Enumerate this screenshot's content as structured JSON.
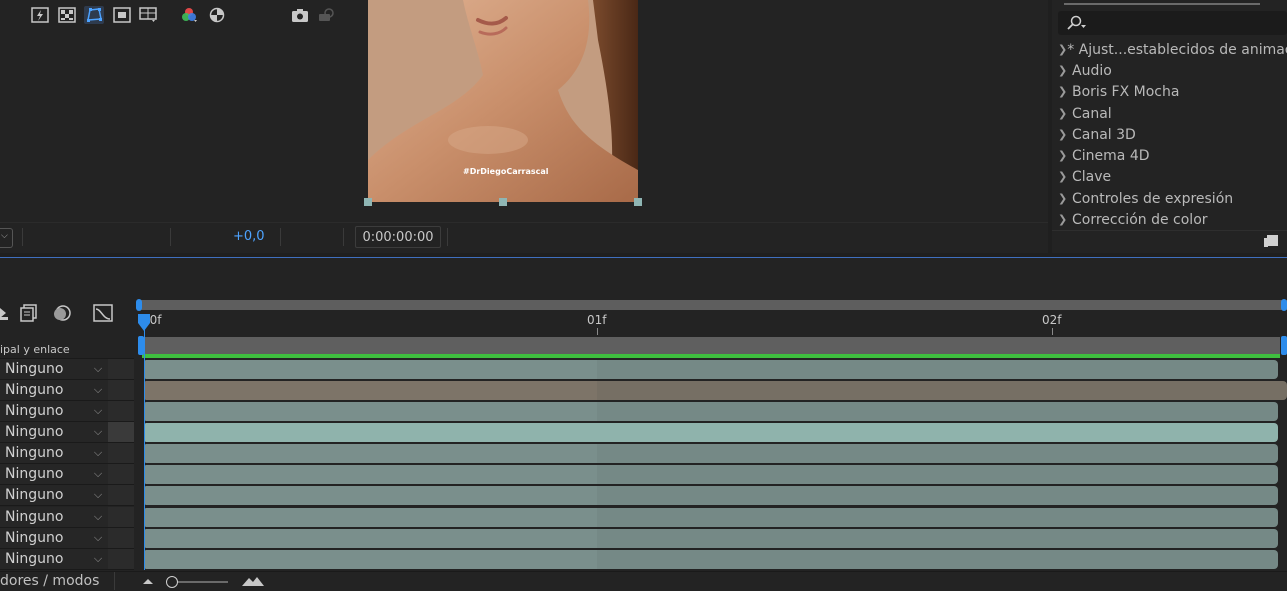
{
  "viewer": {
    "watermark": "#DrDiegoCarrascal"
  },
  "viewer_toolbar": {
    "exposure_value": "+0,0",
    "timecode": "0:00:00:00",
    "icons": [
      "fast-previews-icon",
      "transparency-grid-icon",
      "mask-path-icon",
      "region-of-interest-icon",
      "guides-icon",
      "color-channels-icon",
      "exposure-reset-icon",
      "snapshot-icon",
      "show-snapshot-icon"
    ]
  },
  "effects_panel": {
    "search_placeholder": "",
    "categories": [
      "* Ajust...establecidos de animación",
      "Audio",
      "Boris FX Mocha",
      "Canal",
      "Canal 3D",
      "Cinema 4D",
      "Clave",
      "Controles de expresión",
      "Corrección de color"
    ]
  },
  "timeline": {
    "parent_column_header": "ipal y enlace",
    "footer_label": "dores / modos",
    "ruler_labels": [
      "00f",
      "01f",
      "02f"
    ],
    "layers": [
      {
        "parent": "Ninguno",
        "bar": "teal"
      },
      {
        "parent": "Ninguno",
        "bar": "brown"
      },
      {
        "parent": "Ninguno",
        "bar": "teal"
      },
      {
        "parent": "Ninguno",
        "bar": "selected"
      },
      {
        "parent": "Ninguno",
        "bar": "teal"
      },
      {
        "parent": "Ninguno",
        "bar": "teal"
      },
      {
        "parent": "Ninguno",
        "bar": "teal"
      },
      {
        "parent": "Ninguno",
        "bar": "teal"
      },
      {
        "parent": "Ninguno",
        "bar": "teal"
      },
      {
        "parent": "Ninguno",
        "bar": "teal"
      }
    ]
  },
  "colors": {
    "accent_blue": "#2d8ceb",
    "work_area_green": "#3fbf3f",
    "layer_teal": "#7a8f8c",
    "layer_brown": "#7d7468",
    "layer_selected": "#8fb3ac"
  }
}
